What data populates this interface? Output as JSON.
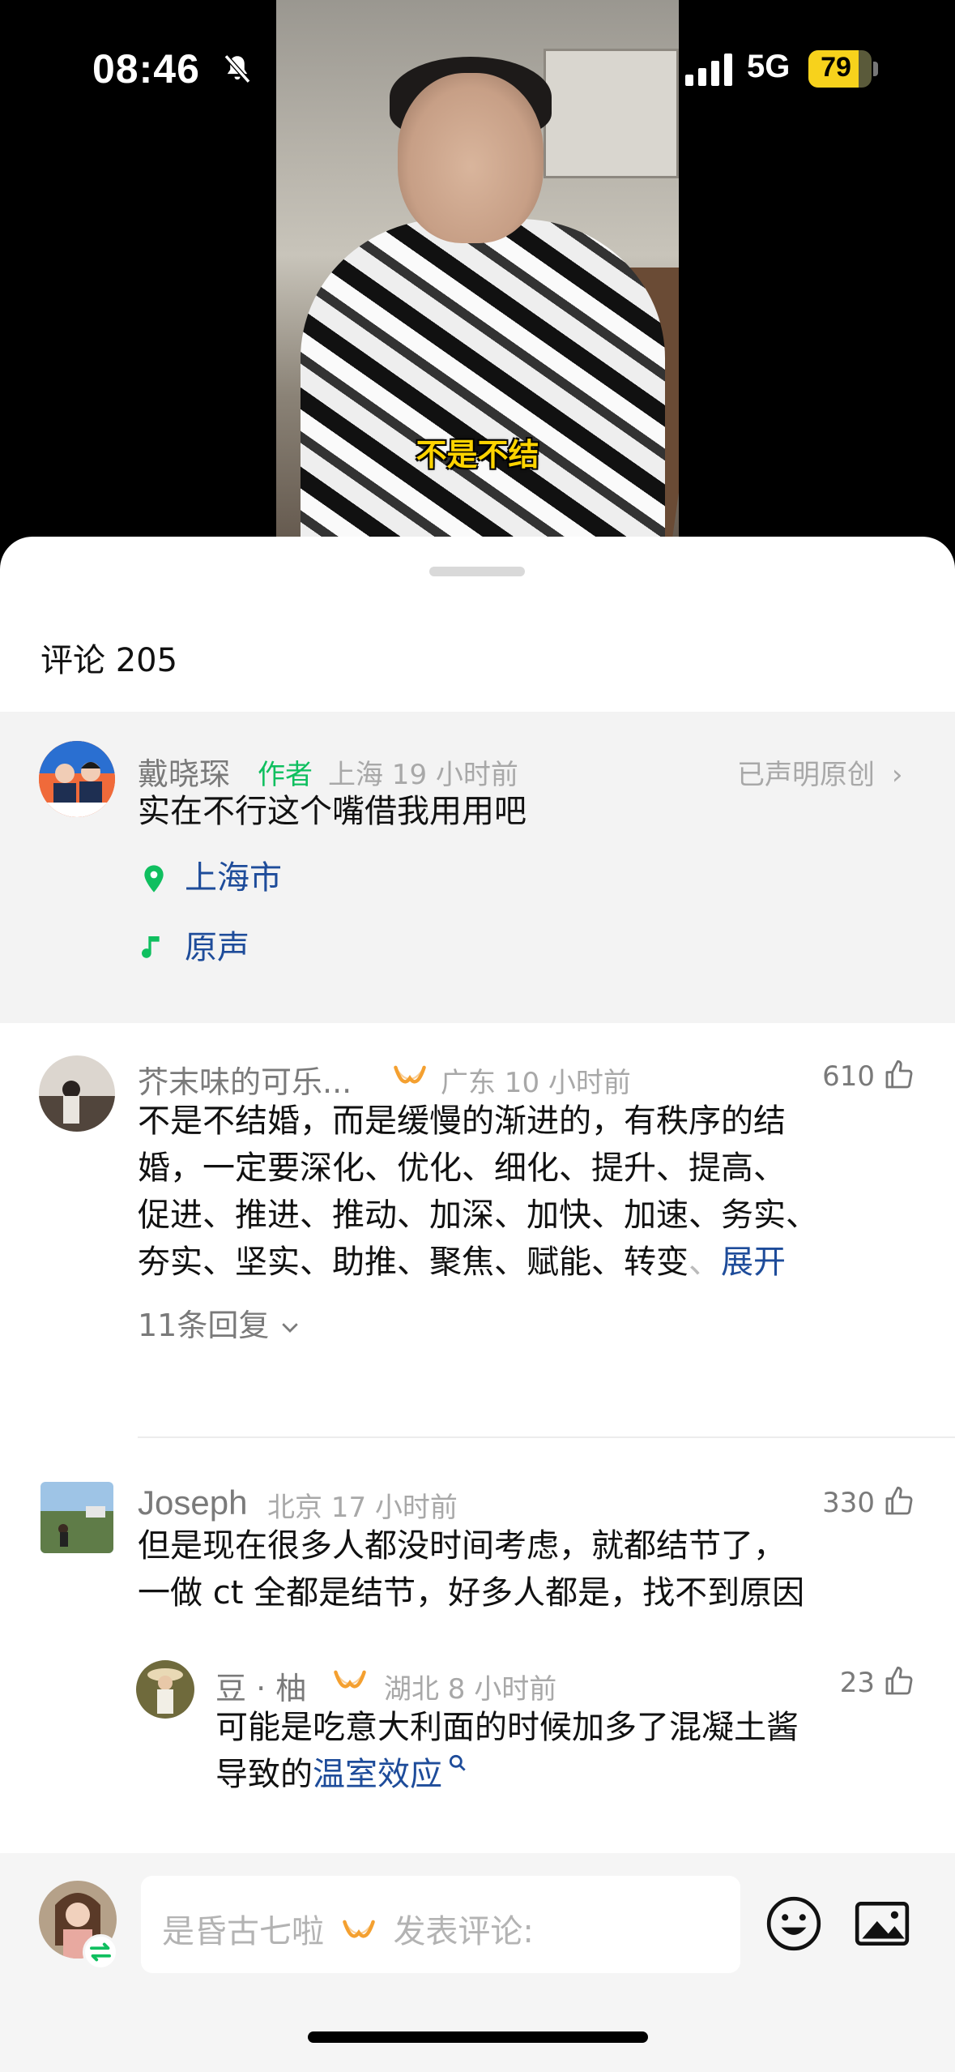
{
  "status_bar": {
    "time": "08:46",
    "network": "5G",
    "battery": "79",
    "battery_level": 0.79
  },
  "video": {
    "caption": "不是不结"
  },
  "sheet": {
    "title": "评论 205"
  },
  "author_comment": {
    "name": "戴晓琛",
    "tag": "作者",
    "location_time": "上海 19 小时前",
    "original_label": "已声明原创",
    "text": "实在不行这个嘴借我用用吧",
    "place": "上海市",
    "sound": "原声"
  },
  "comments": [
    {
      "name": "芥末味的可乐...",
      "location_time": "广东 10 小时前",
      "likes": "610",
      "text_lines": [
        "不是不结婚，而是缓慢的渐进的，有秩序的结",
        "婚，一定要深化、优化、细化、提升、提高、",
        "促进、推进、推动、加深、加快、加速、务实、",
        "夯实、坚实、助推、聚焦、赋能、转变"
      ],
      "expand_label": "展开",
      "replies_label": "11条回复"
    },
    {
      "name": "Joseph",
      "location_time": "北京 17 小时前",
      "likes": "330",
      "text_lines": [
        "但是现在很多人都没时间考虑，就都结节了，",
        "一做 ct 全都是结节，好多人都是，找不到原因"
      ],
      "reply": {
        "name": "豆 · 柚",
        "location_time": "湖北 8 小时前",
        "likes": "23",
        "text_line1": "可能是吃意大利面的时候加多了混凝土酱",
        "text_line2_prefix": "导致的",
        "text_line2_link": "温室效应"
      }
    }
  ],
  "composer": {
    "user_name": "是昏古七啦",
    "placeholder": "发表评论:"
  },
  "colors": {
    "accent_green": "#0fbf5f",
    "link_blue": "#1e4c9a",
    "vip_orange": "#f4a030",
    "caption_yellow": "#ffd400"
  }
}
